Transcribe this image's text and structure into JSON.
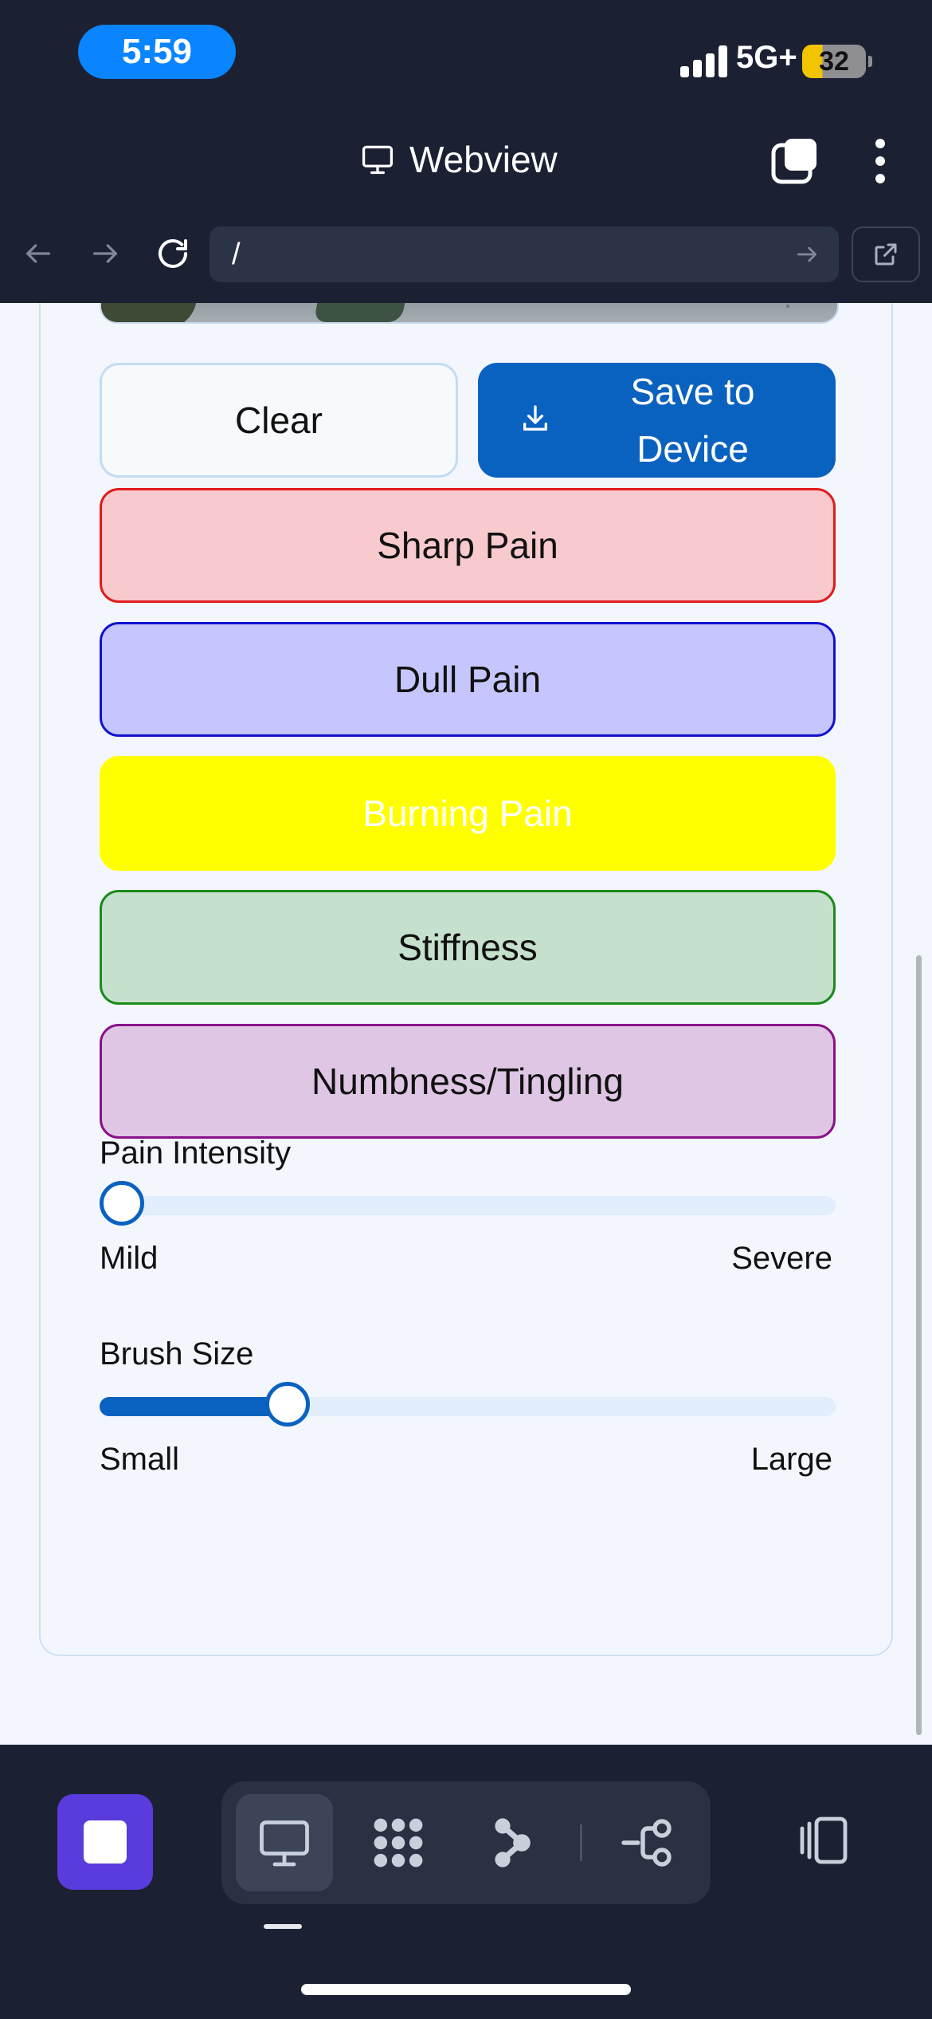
{
  "status_bar": {
    "time": "5:59",
    "network": "5G+",
    "battery": "32"
  },
  "header": {
    "title": "Webview",
    "title_icon": "monitor-icon",
    "tabs_icon": "tabs-icon",
    "menu_icon": "more-vertical-icon"
  },
  "address_bar": {
    "url": "/",
    "back_icon": "arrow-left-icon",
    "forward_icon": "arrow-right-icon",
    "reload_icon": "reload-icon",
    "go_icon": "arrow-right-icon",
    "open_external_icon": "external-link-icon"
  },
  "actions": {
    "clear_label": "Clear",
    "save_label": "Save to Device",
    "save_icon": "download-icon"
  },
  "pain_types": [
    {
      "label": "Sharp Pain",
      "fill": "#f8c9cd",
      "border": "#e01b1b"
    },
    {
      "label": "Dull Pain",
      "fill": "#c6c6fe",
      "border": "#1212cf"
    },
    {
      "label": "Burning Pain",
      "fill": "#ffff00",
      "border": "#ffff00"
    },
    {
      "label": "Stiffness",
      "fill": "#c5e1cd",
      "border": "#1b8a1b"
    },
    {
      "label": "Numbness/Tingling",
      "fill": "#dfc6e4",
      "border": "#8a0f8a"
    }
  ],
  "pain_intensity": {
    "label": "Pain Intensity",
    "min_label": "Mild",
    "max_label": "Severe",
    "value_fraction": 0.0
  },
  "brush_size": {
    "label": "Brush Size",
    "min_label": "Small",
    "max_label": "Large",
    "value_fraction": 0.24
  },
  "dock": {
    "items": [
      "app-icon",
      "monitor-icon",
      "grid-dots-icon",
      "node-graph-icon",
      "flow-icon",
      "side-panel-icon"
    ],
    "active": "monitor-icon"
  },
  "colors": {
    "accent": "#0a62c0",
    "app_accent": "#5a3bdc",
    "chrome_bg": "#1b2132"
  }
}
